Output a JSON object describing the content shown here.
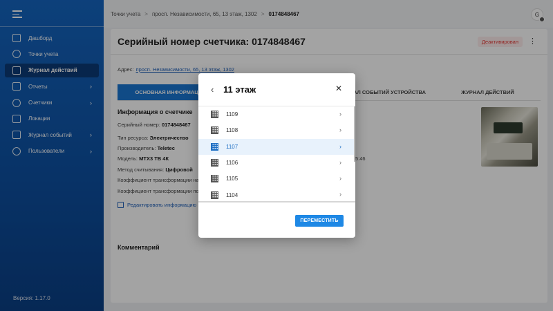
{
  "sidebar": {
    "items": [
      {
        "label": "Дашборд",
        "icon": "chart-icon",
        "active": false,
        "chevron": false
      },
      {
        "label": "Точки учета",
        "icon": "location-pin-icon",
        "active": false,
        "chevron": false
      },
      {
        "label": "Журнал действий",
        "icon": "journal-icon",
        "active": true,
        "chevron": false
      },
      {
        "label": "Отчеты",
        "icon": "report-icon",
        "active": false,
        "chevron": true
      },
      {
        "label": "Счетчики",
        "icon": "meter-icon",
        "active": false,
        "chevron": true
      },
      {
        "label": "Локации",
        "icon": "building-icon",
        "active": false,
        "chevron": false
      },
      {
        "label": "Журнал событий",
        "icon": "calendar-icon",
        "active": false,
        "chevron": true
      },
      {
        "label": "Пользователи",
        "icon": "users-icon",
        "active": false,
        "chevron": true
      }
    ],
    "version": "Версия: 1.17.0"
  },
  "topbar": {
    "breadcrumb": [
      "Точки учета",
      "просп. Независимости, 65, 13 этаж, 1302",
      "0174848467"
    ],
    "breadcrumb_sep": ">",
    "avatar_letter": "G"
  },
  "card": {
    "title": "Серийный номер счетчика: 0174848467",
    "status": "Деактивирован",
    "more": "⋮",
    "address_label": "Адрес:",
    "address_link": "просп. Независимости, 65, 13 этаж, 1302",
    "tabs": [
      "ОСНОВНАЯ ИНФОРМАЦИЯ",
      "",
      "ЖУРНАЛ СОБЫТИЙ УСТРОЙСТВА",
      "ЖУРНАЛ ДЕЙСТВИЙ"
    ],
    "info_title": "Информация о счетчике",
    "info": [
      {
        "label": "Серийный номер:",
        "value": "0174848467"
      },
      {
        "label": "Тип ресурса:",
        "value": "Электричество"
      },
      {
        "label": "Производитель:",
        "value": "Teletec"
      },
      {
        "label": "Модель:",
        "value": "МТХ3 ТВ 4К"
      },
      {
        "label": "Метод считывания:",
        "value": "Цифровой"
      },
      {
        "label": "Коэффициент трансформации на",
        "value": ""
      },
      {
        "label": "Коэффициент трансформации по",
        "value": ""
      }
    ],
    "time_fragment": "5:46",
    "edit_label": "Редактировать информацию",
    "comment_title": "Комментарий"
  },
  "modal": {
    "back": "‹",
    "title": "11 этаж",
    "close": "✕",
    "rooms": [
      {
        "label": "1109",
        "selected": false
      },
      {
        "label": "1108",
        "selected": false
      },
      {
        "label": "1107",
        "selected": true
      },
      {
        "label": "1106",
        "selected": false
      },
      {
        "label": "1105",
        "selected": false
      },
      {
        "label": "1104",
        "selected": false
      }
    ],
    "chevron": "›",
    "move_label": "ПЕРЕМЕСТИТЬ",
    "accent": "#1e88e5"
  }
}
